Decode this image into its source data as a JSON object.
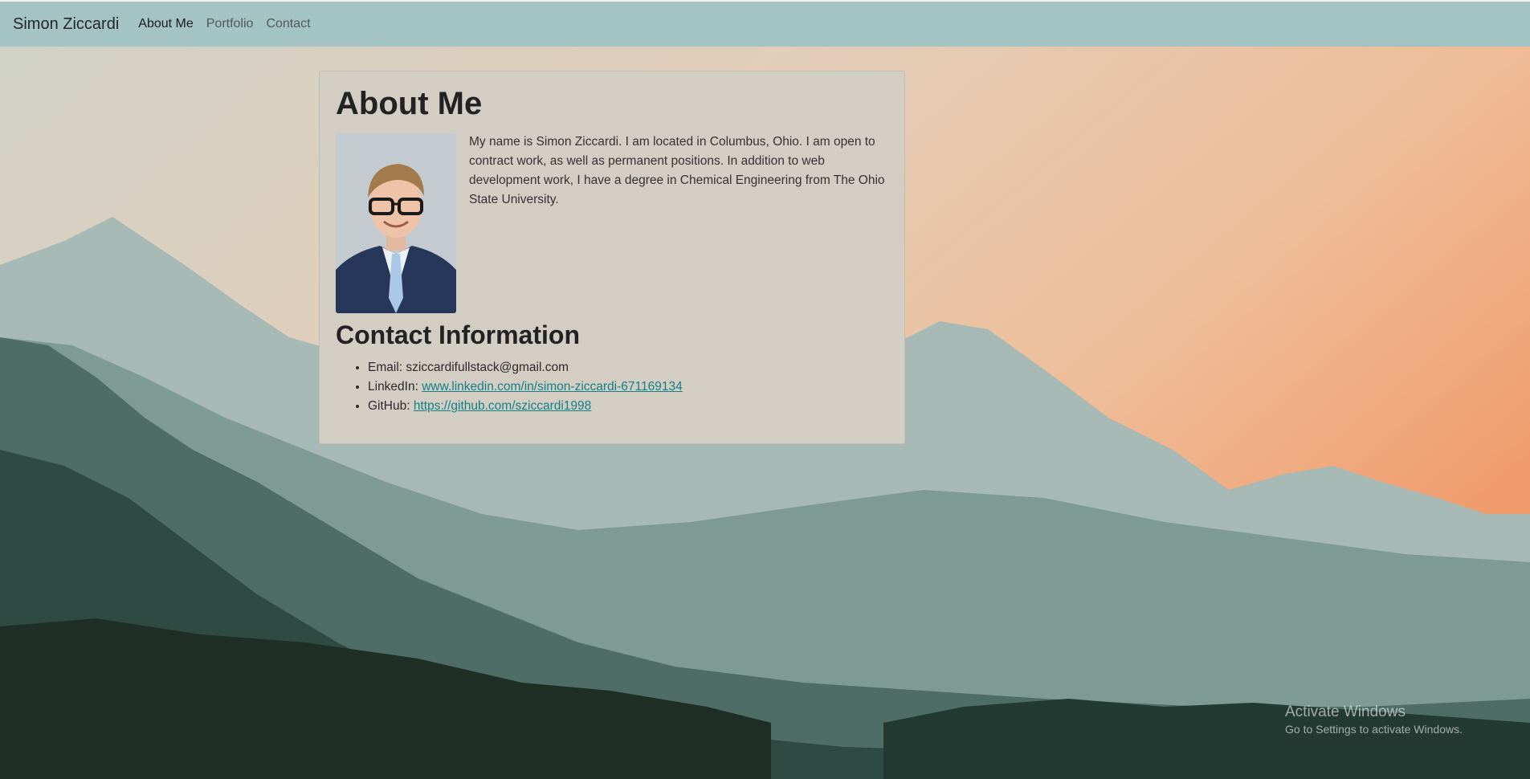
{
  "navbar": {
    "brand": "Simon Ziccardi",
    "links": [
      {
        "label": "About Me",
        "active": true
      },
      {
        "label": "Portfolio",
        "active": false
      },
      {
        "label": "Contact",
        "active": false
      }
    ]
  },
  "about": {
    "title": "About Me",
    "bio": "My name is Simon Ziccardi. I am located in Columbus, Ohio. I am open to contract work, as well as permanent positions. In addition to web development work, I have a degree in Chemical Engineering from The Ohio State University."
  },
  "contact": {
    "title": "Contact Information",
    "email_label": "Email: ",
    "email_value": "sziccardifullstack@gmail.com",
    "linkedin_label": "LinkedIn: ",
    "linkedin_value": "www.linkedin.com/in/simon-ziccardi-671169134",
    "github_label": "GitHub: ",
    "github_value": "https://github.com/sziccardi1998"
  },
  "watermark": {
    "title": "Activate Windows",
    "subtitle": "Go to Settings to activate Windows."
  },
  "colors": {
    "navbar": "#a3c4c2",
    "card": "#d3cec4",
    "link": "#137f86"
  }
}
